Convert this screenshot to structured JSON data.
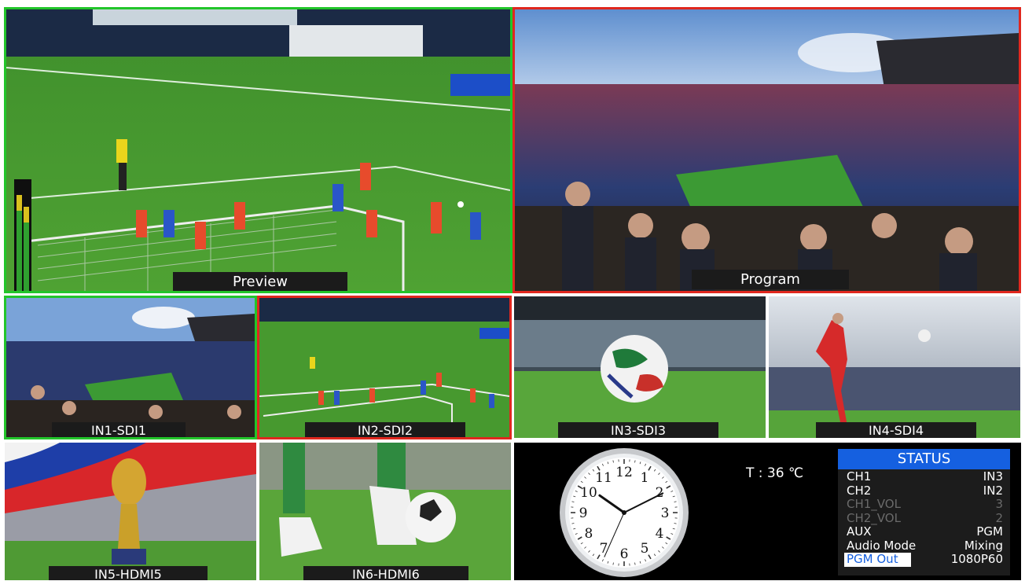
{
  "multiview": {
    "preview_label": "Preview",
    "program_label": "Program",
    "inputs": [
      {
        "label": "IN1-SDI1"
      },
      {
        "label": "IN2-SDI2"
      },
      {
        "label": "IN3-SDI3"
      },
      {
        "label": "IN4-SDI4"
      },
      {
        "label": "IN5-HDMI5"
      },
      {
        "label": "IN6-HDMI6"
      }
    ],
    "tally_colors": {
      "preview": "#22c52a",
      "program": "#e0271e"
    }
  },
  "info": {
    "temperature": "T : 36 ℃"
  },
  "status": {
    "title": "STATUS",
    "rows": [
      {
        "key": "CH1",
        "value": "IN3"
      },
      {
        "key": "CH2",
        "value": "IN2"
      },
      {
        "key": "CH1_VOL",
        "value": "3"
      },
      {
        "key": "CH2_VOL",
        "value": "2"
      },
      {
        "key": "AUX",
        "value": "PGM"
      },
      {
        "key": "Audio Mode",
        "value": "Mixing"
      },
      {
        "key": "PGM Out",
        "value": "1080P60"
      }
    ]
  },
  "clock": {
    "numerals": [
      "12",
      "1",
      "2",
      "3",
      "4",
      "5",
      "6",
      "7",
      "8",
      "9",
      "10",
      "11"
    ],
    "time": {
      "hour": 10,
      "minute": 10,
      "second": 34
    }
  },
  "icons": {
    "clock": "analog-clock-icon",
    "vu": "audio-level-meter-icon"
  }
}
